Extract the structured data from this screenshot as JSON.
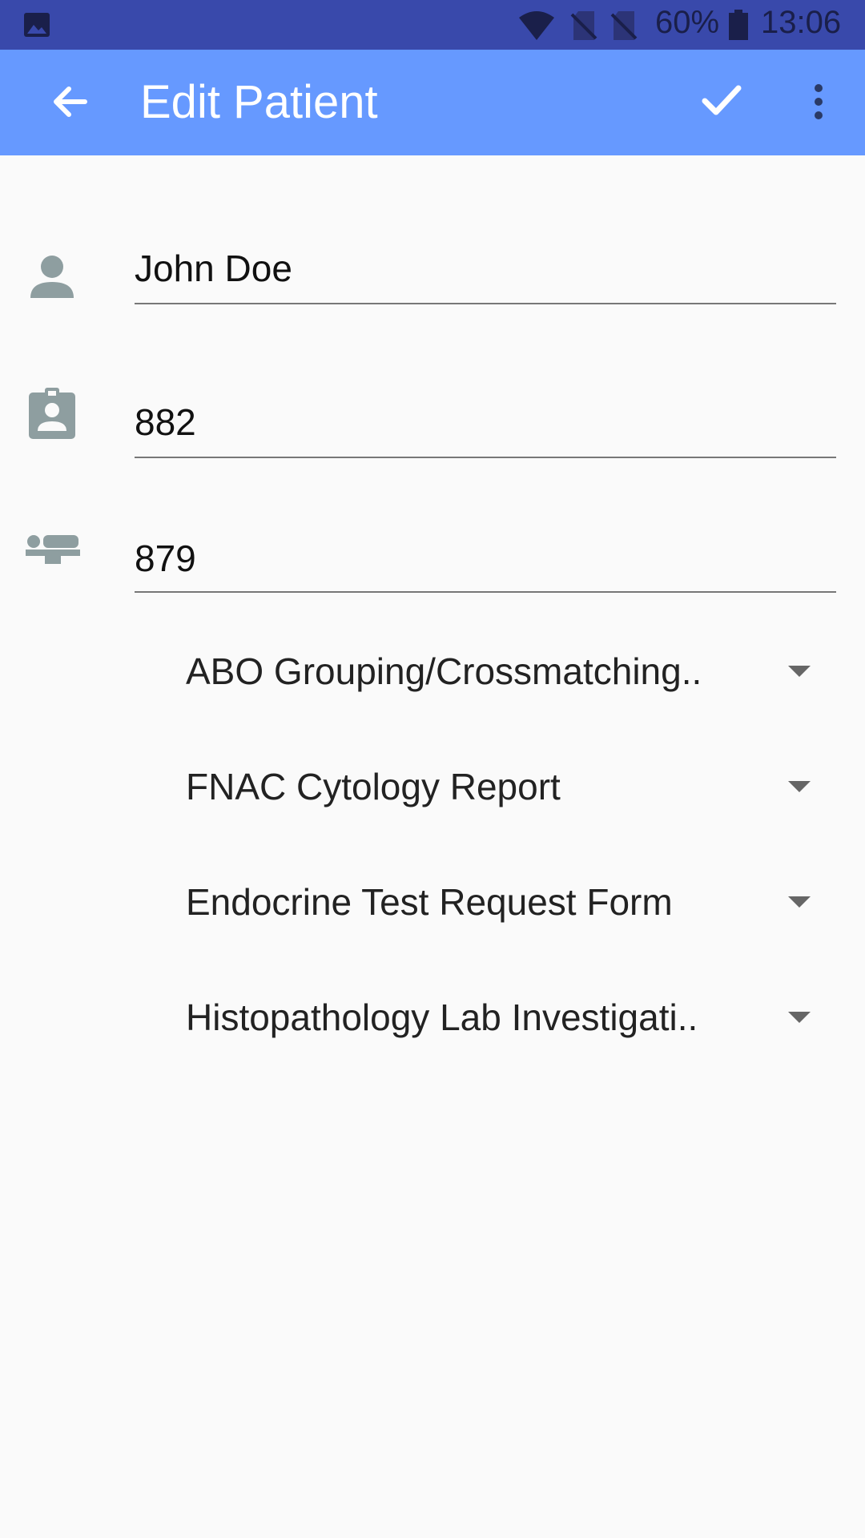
{
  "status_bar": {
    "battery_percent": "60%",
    "time": "13:06"
  },
  "app_bar": {
    "title": "Edit Patient"
  },
  "form": {
    "name_value": "John Doe",
    "id_value": "882",
    "bed_value": "879"
  },
  "spinners": [
    {
      "label": "ABO Grouping/Crossmatching.."
    },
    {
      "label": "FNAC Cytology Report"
    },
    {
      "label": "Endocrine Test Request Form"
    },
    {
      "label": "Histopathology Lab Investigati.."
    }
  ],
  "colors": {
    "status_bar": "#3949ab",
    "app_bar": "#6699ff",
    "icon_gray": "#8e9ea0"
  }
}
